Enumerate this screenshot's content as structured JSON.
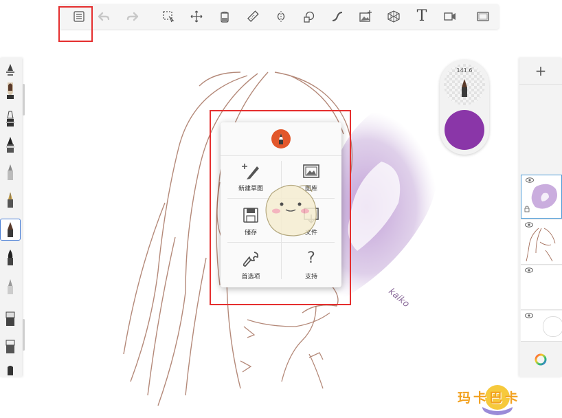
{
  "toolbar": {
    "tools": [
      {
        "name": "menu-list-icon",
        "interactable": true
      },
      {
        "name": "undo-icon",
        "interactable": false
      },
      {
        "name": "redo-icon",
        "interactable": false
      },
      {
        "name": "select-icon",
        "interactable": true
      },
      {
        "name": "transform-icon",
        "interactable": true
      },
      {
        "name": "fill-icon",
        "interactable": true
      },
      {
        "name": "ruler-icon",
        "interactable": true
      },
      {
        "name": "symmetry-icon",
        "interactable": true
      },
      {
        "name": "shape-icon",
        "interactable": true
      },
      {
        "name": "stroke-icon",
        "interactable": true
      },
      {
        "name": "add-image-icon",
        "interactable": true
      },
      {
        "name": "perspective-icon",
        "interactable": true
      },
      {
        "name": "text-icon",
        "interactable": true
      },
      {
        "name": "video-icon",
        "interactable": true
      },
      {
        "name": "fullscreen-icon",
        "interactable": true
      }
    ],
    "text_tool_glyph": "T"
  },
  "brush_puck": {
    "size_value": "141.6",
    "color": "#8a36a8"
  },
  "menu": {
    "items": [
      {
        "label": "新建草图",
        "icon": "new-sketch-icon"
      },
      {
        "label": "图库",
        "icon": "gallery-icon"
      },
      {
        "label": "储存",
        "icon": "save-icon"
      },
      {
        "label": "文件",
        "icon": "file-icon"
      },
      {
        "label": "首选项",
        "icon": "wrench-icon"
      },
      {
        "label": "支持",
        "icon": "help-icon"
      }
    ],
    "help_glyph": "?"
  },
  "layers": {
    "add_glyph": "+"
  },
  "watermark": {
    "text": "玛卡巴卡"
  },
  "colors": {
    "accent_red": "#e52e2e",
    "selection_blue": "#4a7fd6",
    "brush_color": "#8a36a8",
    "logo_orange": "#e2572b"
  }
}
